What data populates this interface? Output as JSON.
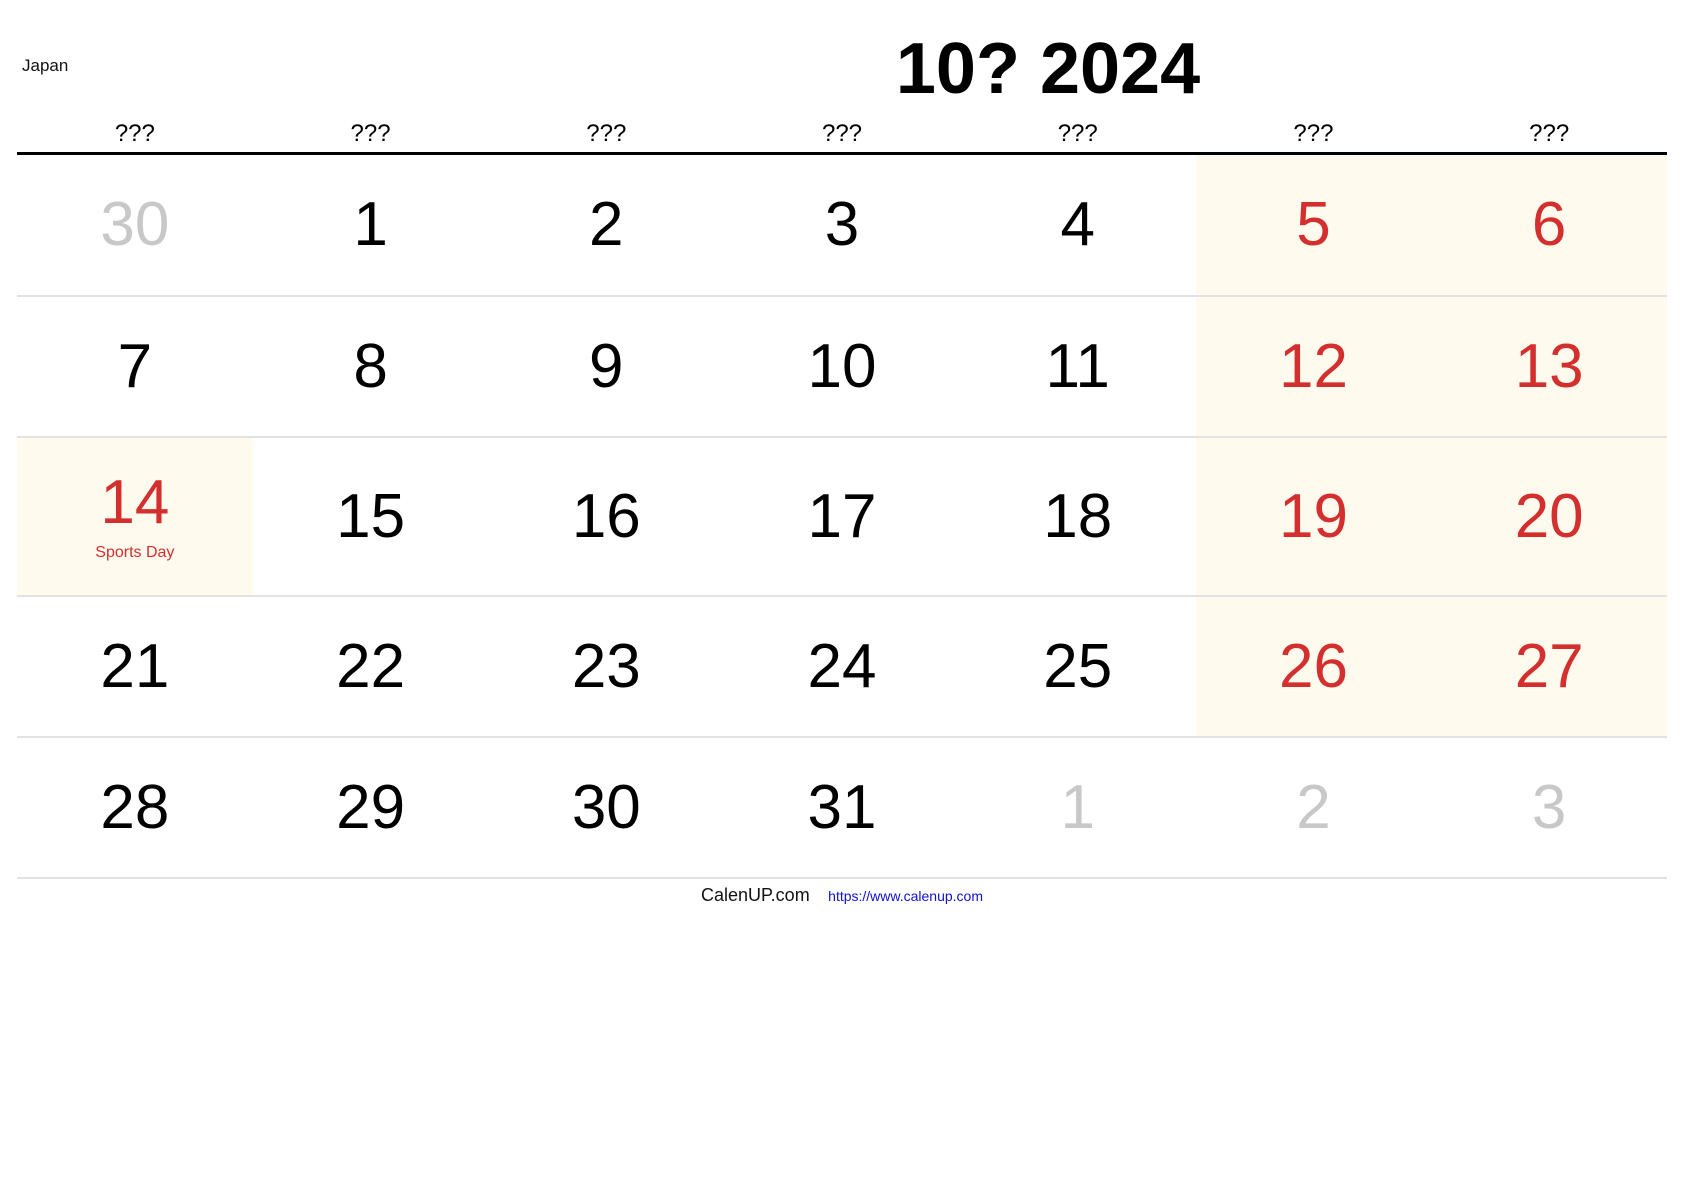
{
  "country": "Japan",
  "title": "10? 2024",
  "weekday_headers": [
    "???",
    "???",
    "???",
    "???",
    "???",
    "???",
    "???"
  ],
  "colors": {
    "weekend_text": "#d32f2f",
    "weekend_background": "#fffaee",
    "other_month_text": "#c8c8c8",
    "link": "#1010d0"
  },
  "weeks": [
    [
      {
        "day": "30",
        "type": "other"
      },
      {
        "day": "1",
        "type": "normal"
      },
      {
        "day": "2",
        "type": "normal"
      },
      {
        "day": "3",
        "type": "normal"
      },
      {
        "day": "4",
        "type": "normal"
      },
      {
        "day": "5",
        "type": "weekend"
      },
      {
        "day": "6",
        "type": "weekend"
      }
    ],
    [
      {
        "day": "7",
        "type": "normal"
      },
      {
        "day": "8",
        "type": "normal"
      },
      {
        "day": "9",
        "type": "normal"
      },
      {
        "day": "10",
        "type": "normal"
      },
      {
        "day": "11",
        "type": "normal"
      },
      {
        "day": "12",
        "type": "weekend"
      },
      {
        "day": "13",
        "type": "weekend"
      }
    ],
    [
      {
        "day": "14",
        "type": "holiday",
        "label": "Sports Day"
      },
      {
        "day": "15",
        "type": "normal"
      },
      {
        "day": "16",
        "type": "normal"
      },
      {
        "day": "17",
        "type": "normal"
      },
      {
        "day": "18",
        "type": "normal"
      },
      {
        "day": "19",
        "type": "weekend"
      },
      {
        "day": "20",
        "type": "weekend"
      }
    ],
    [
      {
        "day": "21",
        "type": "normal"
      },
      {
        "day": "22",
        "type": "normal"
      },
      {
        "day": "23",
        "type": "normal"
      },
      {
        "day": "24",
        "type": "normal"
      },
      {
        "day": "25",
        "type": "normal"
      },
      {
        "day": "26",
        "type": "weekend"
      },
      {
        "day": "27",
        "type": "weekend"
      }
    ],
    [
      {
        "day": "28",
        "type": "normal"
      },
      {
        "day": "29",
        "type": "normal"
      },
      {
        "day": "30",
        "type": "normal"
      },
      {
        "day": "31",
        "type": "normal"
      },
      {
        "day": "1",
        "type": "other"
      },
      {
        "day": "2",
        "type": "other"
      },
      {
        "day": "3",
        "type": "other"
      }
    ]
  ],
  "footer": {
    "brand": "CalenUP.com",
    "url": "https://www.calenup.com"
  }
}
